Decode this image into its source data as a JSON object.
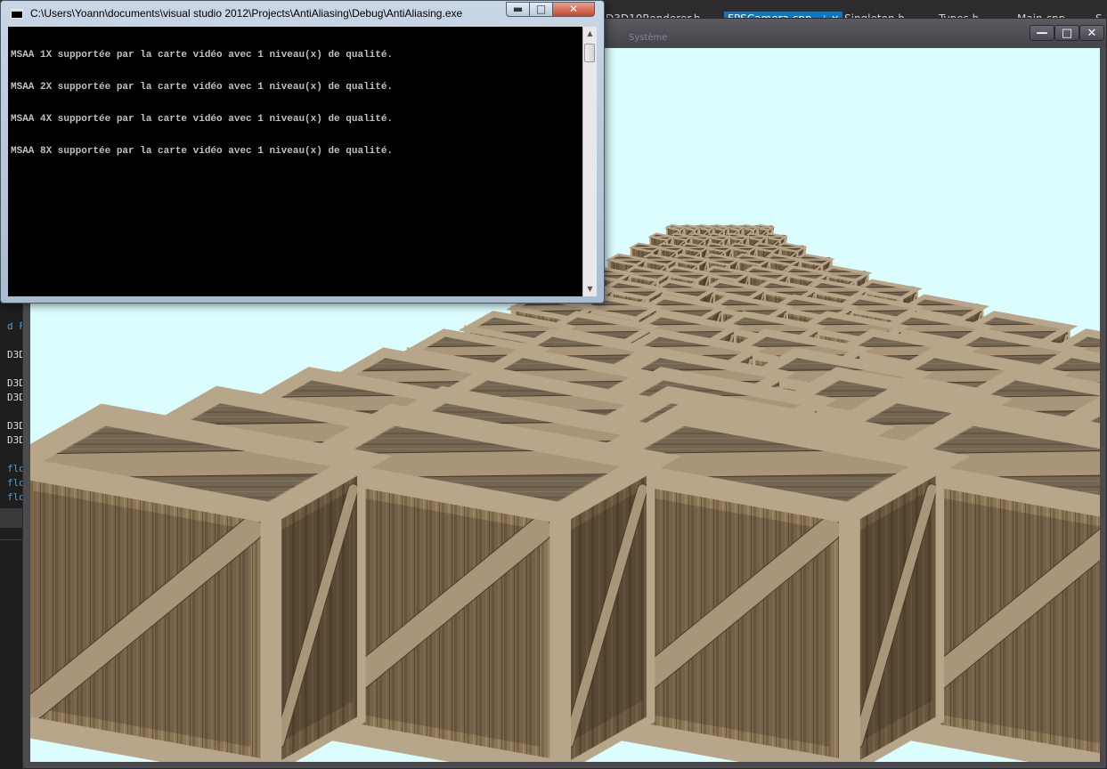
{
  "ide": {
    "tabs": [
      {
        "label": "D3D10Renderer.h",
        "active": false
      },
      {
        "label": "FPSCamera.cpp",
        "active": true
      },
      {
        "label": "Singleton.h",
        "active": false
      },
      {
        "label": "Types.h",
        "active": false
      },
      {
        "label": "Main.cpp",
        "active": false
      },
      {
        "label": "S",
        "active": false
      }
    ],
    "pin_glyph": "⊣",
    "close_glyph": "✕",
    "code_fragments": [
      "d FP",
      "D3D",
      "D3D",
      "D3D",
      "D3D",
      "D3D",
      "flo",
      "flo",
      "flo"
    ]
  },
  "render_window": {
    "title": "Système",
    "buttons": {
      "minimize": "—",
      "maximize": "□",
      "close": "✕"
    },
    "colors": {
      "sky": "#dcfdfd"
    }
  },
  "console": {
    "title": "C:\\Users\\Yoann\\documents\\visual studio 2012\\Projects\\AntiAliasing\\Debug\\AntiAliasing.exe",
    "buttons": {
      "minimize": "▬",
      "maximize": "□",
      "close": "✕"
    },
    "lines": [
      "MSAA 1X supportée par la carte vidéo avec 1 niveau(x) de qualité.",
      "MSAA 2X supportée par la carte vidéo avec 1 niveau(x) de qualité.",
      "MSAA 4X supportée par la carte vidéo avec 1 niveau(x) de qualité.",
      "MSAA 8X supportée par la carte vidéo avec 1 niveau(x) de qualité."
    ],
    "scroll_up": "▲",
    "scroll_down": "▼"
  },
  "scene": {
    "description_icon": "wooden-crate",
    "colors": {
      "wood_light": "#b7a58a",
      "wood_mid": "#8b7658",
      "wood_dark": "#5c4a36",
      "wood_top": "#a0907a"
    }
  }
}
